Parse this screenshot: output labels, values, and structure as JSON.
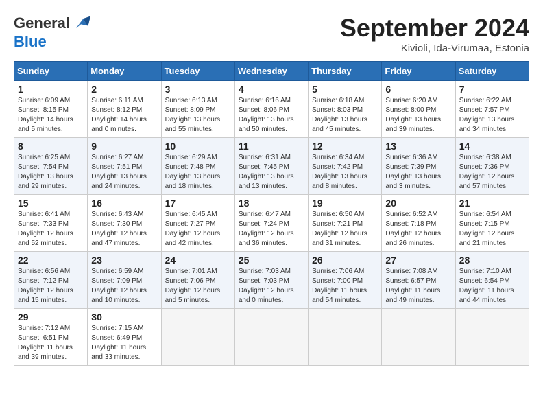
{
  "header": {
    "logo_general": "General",
    "logo_blue": "Blue",
    "month_title": "September 2024",
    "location": "Kivioli, Ida-Virumaa, Estonia"
  },
  "weekdays": [
    "Sunday",
    "Monday",
    "Tuesday",
    "Wednesday",
    "Thursday",
    "Friday",
    "Saturday"
  ],
  "weeks": [
    [
      {
        "day": 1,
        "info": "Sunrise: 6:09 AM\nSunset: 8:15 PM\nDaylight: 14 hours\nand 5 minutes."
      },
      {
        "day": 2,
        "info": "Sunrise: 6:11 AM\nSunset: 8:12 PM\nDaylight: 14 hours\nand 0 minutes."
      },
      {
        "day": 3,
        "info": "Sunrise: 6:13 AM\nSunset: 8:09 PM\nDaylight: 13 hours\nand 55 minutes."
      },
      {
        "day": 4,
        "info": "Sunrise: 6:16 AM\nSunset: 8:06 PM\nDaylight: 13 hours\nand 50 minutes."
      },
      {
        "day": 5,
        "info": "Sunrise: 6:18 AM\nSunset: 8:03 PM\nDaylight: 13 hours\nand 45 minutes."
      },
      {
        "day": 6,
        "info": "Sunrise: 6:20 AM\nSunset: 8:00 PM\nDaylight: 13 hours\nand 39 minutes."
      },
      {
        "day": 7,
        "info": "Sunrise: 6:22 AM\nSunset: 7:57 PM\nDaylight: 13 hours\nand 34 minutes."
      }
    ],
    [
      {
        "day": 8,
        "info": "Sunrise: 6:25 AM\nSunset: 7:54 PM\nDaylight: 13 hours\nand 29 minutes."
      },
      {
        "day": 9,
        "info": "Sunrise: 6:27 AM\nSunset: 7:51 PM\nDaylight: 13 hours\nand 24 minutes."
      },
      {
        "day": 10,
        "info": "Sunrise: 6:29 AM\nSunset: 7:48 PM\nDaylight: 13 hours\nand 18 minutes."
      },
      {
        "day": 11,
        "info": "Sunrise: 6:31 AM\nSunset: 7:45 PM\nDaylight: 13 hours\nand 13 minutes."
      },
      {
        "day": 12,
        "info": "Sunrise: 6:34 AM\nSunset: 7:42 PM\nDaylight: 13 hours\nand 8 minutes."
      },
      {
        "day": 13,
        "info": "Sunrise: 6:36 AM\nSunset: 7:39 PM\nDaylight: 13 hours\nand 3 minutes."
      },
      {
        "day": 14,
        "info": "Sunrise: 6:38 AM\nSunset: 7:36 PM\nDaylight: 12 hours\nand 57 minutes."
      }
    ],
    [
      {
        "day": 15,
        "info": "Sunrise: 6:41 AM\nSunset: 7:33 PM\nDaylight: 12 hours\nand 52 minutes."
      },
      {
        "day": 16,
        "info": "Sunrise: 6:43 AM\nSunset: 7:30 PM\nDaylight: 12 hours\nand 47 minutes."
      },
      {
        "day": 17,
        "info": "Sunrise: 6:45 AM\nSunset: 7:27 PM\nDaylight: 12 hours\nand 42 minutes."
      },
      {
        "day": 18,
        "info": "Sunrise: 6:47 AM\nSunset: 7:24 PM\nDaylight: 12 hours\nand 36 minutes."
      },
      {
        "day": 19,
        "info": "Sunrise: 6:50 AM\nSunset: 7:21 PM\nDaylight: 12 hours\nand 31 minutes."
      },
      {
        "day": 20,
        "info": "Sunrise: 6:52 AM\nSunset: 7:18 PM\nDaylight: 12 hours\nand 26 minutes."
      },
      {
        "day": 21,
        "info": "Sunrise: 6:54 AM\nSunset: 7:15 PM\nDaylight: 12 hours\nand 21 minutes."
      }
    ],
    [
      {
        "day": 22,
        "info": "Sunrise: 6:56 AM\nSunset: 7:12 PM\nDaylight: 12 hours\nand 15 minutes."
      },
      {
        "day": 23,
        "info": "Sunrise: 6:59 AM\nSunset: 7:09 PM\nDaylight: 12 hours\nand 10 minutes."
      },
      {
        "day": 24,
        "info": "Sunrise: 7:01 AM\nSunset: 7:06 PM\nDaylight: 12 hours\nand 5 minutes."
      },
      {
        "day": 25,
        "info": "Sunrise: 7:03 AM\nSunset: 7:03 PM\nDaylight: 12 hours\nand 0 minutes."
      },
      {
        "day": 26,
        "info": "Sunrise: 7:06 AM\nSunset: 7:00 PM\nDaylight: 11 hours\nand 54 minutes."
      },
      {
        "day": 27,
        "info": "Sunrise: 7:08 AM\nSunset: 6:57 PM\nDaylight: 11 hours\nand 49 minutes."
      },
      {
        "day": 28,
        "info": "Sunrise: 7:10 AM\nSunset: 6:54 PM\nDaylight: 11 hours\nand 44 minutes."
      }
    ],
    [
      {
        "day": 29,
        "info": "Sunrise: 7:12 AM\nSunset: 6:51 PM\nDaylight: 11 hours\nand 39 minutes."
      },
      {
        "day": 30,
        "info": "Sunrise: 7:15 AM\nSunset: 6:49 PM\nDaylight: 11 hours\nand 33 minutes."
      },
      {
        "day": null,
        "info": ""
      },
      {
        "day": null,
        "info": ""
      },
      {
        "day": null,
        "info": ""
      },
      {
        "day": null,
        "info": ""
      },
      {
        "day": null,
        "info": ""
      }
    ]
  ]
}
